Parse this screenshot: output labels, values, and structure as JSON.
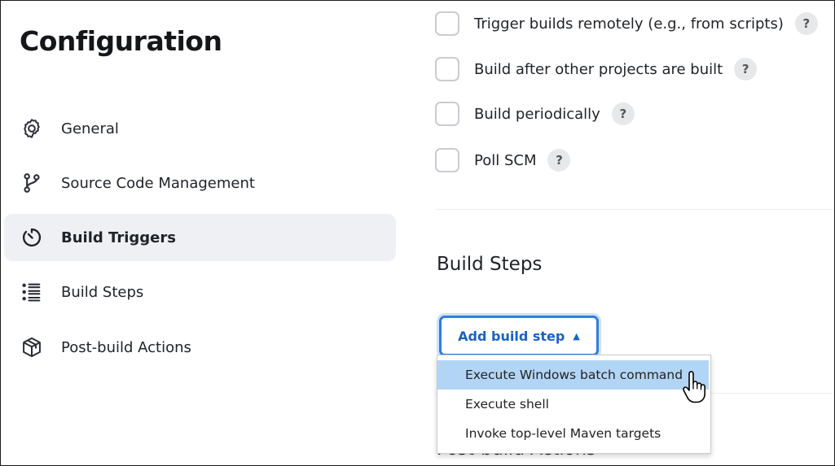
{
  "sidebar": {
    "title": "Configuration",
    "items": [
      {
        "label": "General",
        "icon": "gear-icon",
        "active": false
      },
      {
        "label": "Source Code Management",
        "icon": "branch-icon",
        "active": false
      },
      {
        "label": "Build Triggers",
        "icon": "timer-icon",
        "active": true
      },
      {
        "label": "Build Steps",
        "icon": "list-icon",
        "active": false
      },
      {
        "label": "Post-build Actions",
        "icon": "package-icon",
        "active": false
      }
    ]
  },
  "triggers": {
    "options": [
      {
        "label": "Trigger builds remotely (e.g., from scripts)",
        "checked": false,
        "help": "?"
      },
      {
        "label": "Build after other projects are built",
        "checked": false,
        "help": "?"
      },
      {
        "label": "Build periodically",
        "checked": false,
        "help": "?"
      },
      {
        "label": "Poll SCM",
        "checked": false,
        "help": "?"
      }
    ]
  },
  "build_steps": {
    "title": "Build Steps",
    "add_button": "Add build step",
    "caret": "▲",
    "menu": [
      {
        "label": "Execute Windows batch command",
        "highlighted": true
      },
      {
        "label": "Execute shell",
        "highlighted": false
      },
      {
        "label": "Invoke top-level Maven targets",
        "highlighted": false
      }
    ]
  },
  "post_build": {
    "title": "Post-build Actions"
  },
  "colors": {
    "accent": "#2f7ee0",
    "active_nav_bg": "#eef0f3",
    "menu_highlight": "#b3d5f5"
  }
}
